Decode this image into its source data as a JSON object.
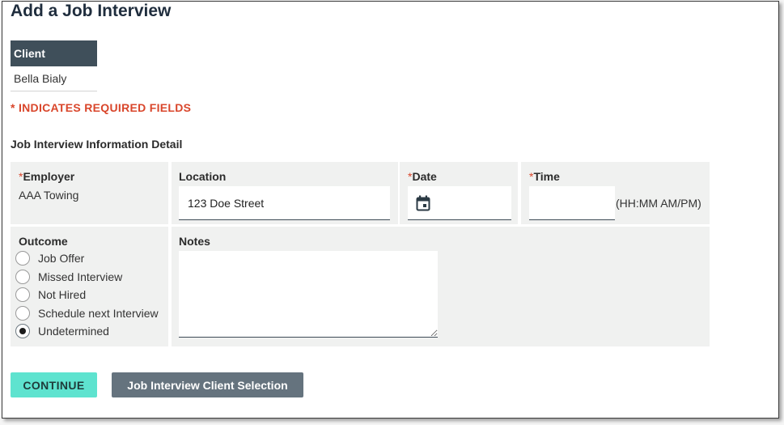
{
  "page": {
    "title": "Add a Job Interview"
  },
  "client_table": {
    "header": "Client",
    "value": "Bella Bialy"
  },
  "required_note": "* INDICATES REQUIRED FIELDS",
  "section": {
    "title": "Job Interview Information Detail"
  },
  "form": {
    "employer": {
      "required_mark": "*",
      "label": "Employer",
      "value": "AAA Towing"
    },
    "location": {
      "label": "Location",
      "value": "123 Doe Street"
    },
    "date": {
      "required_mark": "*",
      "label": "Date",
      "value": "",
      "icon": "calendar-icon"
    },
    "time": {
      "required_mark": "*",
      "label": "Time",
      "value": "",
      "hint": "(HH:MM AM/PM)"
    },
    "outcome": {
      "label": "Outcome",
      "options": [
        "Job Offer",
        "Missed Interview",
        "Not Hired",
        "Schedule next Interview",
        "Undetermined"
      ],
      "selected": "Undetermined"
    },
    "notes": {
      "label": "Notes",
      "value": ""
    }
  },
  "buttons": {
    "continue_label": "CONTINUE",
    "selection_label": "Job Interview Client Selection"
  },
  "colors": {
    "accent_teal": "#5ee3cf",
    "required_red": "#d9462b",
    "header_dark": "#3f4f5a",
    "button_gray": "#65737e"
  }
}
